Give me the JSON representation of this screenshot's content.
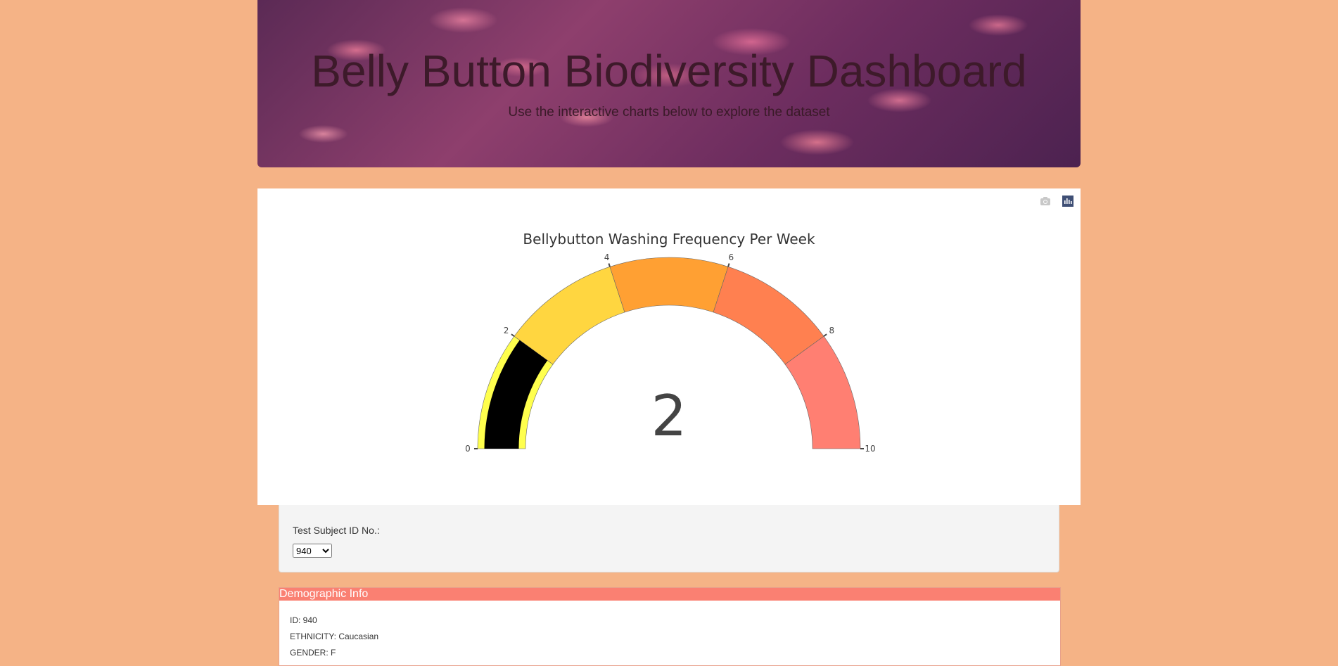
{
  "header": {
    "title": "Belly Button Biodiversity Dashboard",
    "subtitle": "Use the interactive charts below to explore the dataset"
  },
  "modebar": {
    "camera_icon": "camera-icon",
    "plotly_icon": "plotly-logo-icon"
  },
  "chart_data": {
    "type": "gauge",
    "title": "Bellybutton Washing Frequency Per Week",
    "value": 2,
    "value_label": "2",
    "range": [
      0,
      10
    ],
    "ticks": [
      "0",
      "2",
      "4",
      "6",
      "8",
      "10"
    ],
    "bar_color": "#000000",
    "steps": [
      {
        "range": [
          0,
          2
        ],
        "color": "#ffff4d"
      },
      {
        "range": [
          2,
          4
        ],
        "color": "#ffd640"
      },
      {
        "range": [
          4,
          6
        ],
        "color": "#ffa033"
      },
      {
        "range": [
          6,
          8
        ],
        "color": "#ff8050"
      },
      {
        "range": [
          8,
          10
        ],
        "color": "#ff7f72"
      }
    ]
  },
  "selector": {
    "label": "Test Subject ID No.:",
    "selected": "940",
    "options": [
      "940"
    ]
  },
  "demographics": {
    "heading": "Demographic Info",
    "rows": [
      "ID: 940",
      "ETHNICITY: Caucasian",
      "GENDER: F"
    ]
  },
  "colors": {
    "page_bg": "#f5b386",
    "demo_heading_bg": "#fa8072"
  }
}
